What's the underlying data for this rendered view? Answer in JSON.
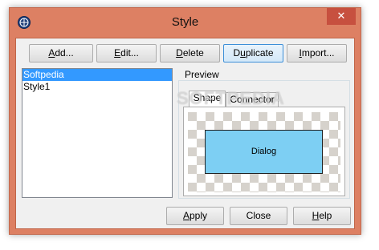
{
  "window": {
    "title": "Style",
    "close_glyph": "✕",
    "icon": "app-globe-icon",
    "colors": {
      "frame": "#dd8063",
      "close": "#c7503f",
      "selection": "#3399ff",
      "shape_fill": "#7dcff3"
    }
  },
  "toolbar": {
    "add": {
      "pre": "",
      "key": "A",
      "post": "dd..."
    },
    "edit": {
      "pre": "",
      "key": "E",
      "post": "dit..."
    },
    "delete": {
      "pre": "",
      "key": "D",
      "post": "elete"
    },
    "duplicate": {
      "pre": "D",
      "key": "u",
      "post": "plicate"
    },
    "import": {
      "pre": "",
      "key": "I",
      "post": "mport..."
    }
  },
  "styles_list": {
    "items": [
      {
        "label": "Softpedia",
        "selected": true
      },
      {
        "label": "Style1",
        "selected": false
      }
    ]
  },
  "preview": {
    "label": "Preview",
    "tabs": [
      {
        "label": "Shape",
        "active": true
      },
      {
        "label": "Connector",
        "active": false
      }
    ],
    "shape_text": "Dialog"
  },
  "watermark": "SOFTPEDIA",
  "footer": {
    "apply": {
      "pre": "",
      "key": "A",
      "post": "pply"
    },
    "close": "Close",
    "help": {
      "pre": "",
      "key": "H",
      "post": "elp"
    }
  }
}
